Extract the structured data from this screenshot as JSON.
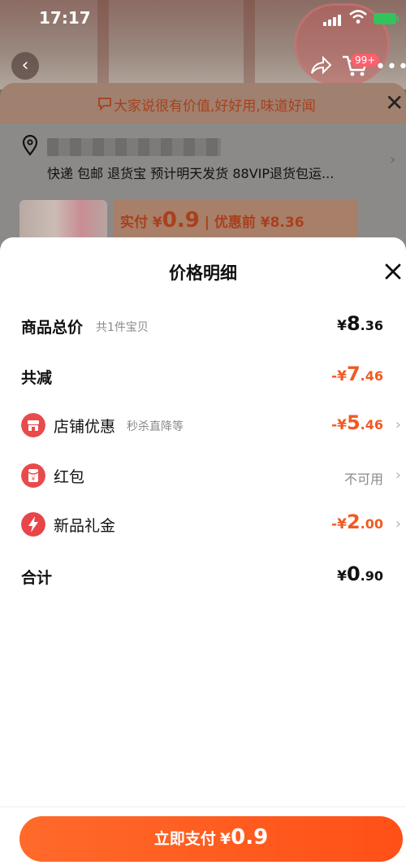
{
  "status_bar": {
    "time": "17:17"
  },
  "background": {
    "cart_badge": "99+",
    "promo_text": "大家说很有价值,好好用,味道好闻",
    "delivery_text": "快递 包邮 退货宝 预计明天发货 88VIP退货包运...",
    "pay_real_label": "实付 ¥",
    "pay_real_amount": "0.9",
    "pay_before": "| 优惠前 ¥8.36"
  },
  "sheet": {
    "title": "价格明细",
    "rows": [
      {
        "label": "商品总价",
        "sub": "共1件宝贝",
        "cur": "¥",
        "int": "8",
        "dec": ".36"
      },
      {
        "label": "共减",
        "cur": "-¥",
        "int": "7",
        "dec": ".46"
      },
      {
        "label": "店铺优惠",
        "sub": "秒杀直降等",
        "cur": "-¥",
        "int": "5",
        "dec": ".46"
      },
      {
        "label": "红包",
        "note": "不可用"
      },
      {
        "label": "新品礼金",
        "cur": "-¥",
        "int": "2",
        "dec": ".00"
      },
      {
        "label": "合计",
        "cur": "¥",
        "int": "0",
        "dec": ".90"
      }
    ],
    "pay_button": {
      "label": "立即支付",
      "cur": "¥",
      "amount": "0.9"
    }
  },
  "colors": {
    "accent": "#f05a23",
    "button": "#ff5a20",
    "shop_icon": "#e84b4b",
    "redpacket_icon": "#e84b4b",
    "giftmoney_icon": "#e8444a"
  }
}
